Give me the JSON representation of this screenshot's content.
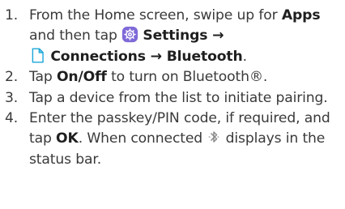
{
  "steps": [
    {
      "number": "1.",
      "t1": "From the Home screen, swipe up for ",
      "apps": "Apps",
      "t2": "and then tap ",
      "settings": "Settings",
      "arrow1": " →",
      "connections": "Connections",
      "arrow2": " → ",
      "bluetooth": "Bluetooth",
      "end": "."
    },
    {
      "number": "2.",
      "t1": "Tap ",
      "onoff": "On/Off",
      "t2": " to turn on Bluetooth®."
    },
    {
      "number": "3.",
      "t1": "Tap a device from the list to initiate pairing."
    },
    {
      "number": "4.",
      "t1": "Enter the passkey/PIN code, if required, and tap ",
      "ok": "OK",
      "t2": ". When connected ",
      "t3": " displays in the status bar."
    }
  ],
  "icons": {
    "settings": "settings-gear-icon",
    "connections": "connections-icon",
    "bluetooth": "bluetooth-icon"
  },
  "colors": {
    "settings_icon": "#7f6ad8",
    "connections_icon": "#1aa6d8",
    "bluetooth_icon": "#8a8a8a"
  }
}
